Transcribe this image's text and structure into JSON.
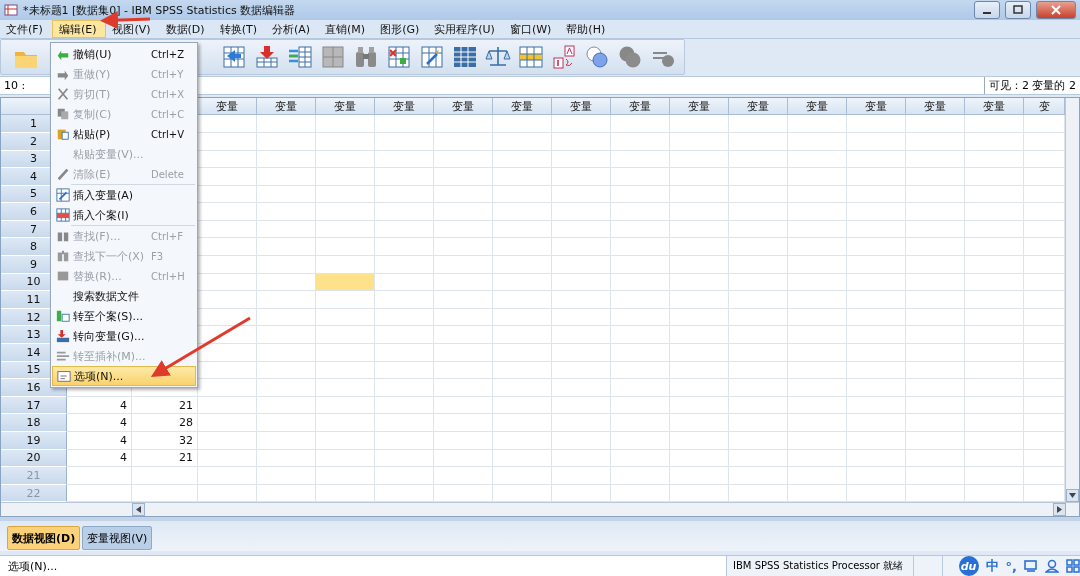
{
  "window": {
    "title": "*未标题1 [数据集0] - IBM SPSS Statistics 数据编辑器"
  },
  "menu_bar": [
    {
      "label": "文件(F)",
      "selected": false
    },
    {
      "label": "编辑(E)",
      "selected": true
    },
    {
      "label": "视图(V)",
      "selected": false
    },
    {
      "label": "数据(D)",
      "selected": false
    },
    {
      "label": "转换(T)",
      "selected": false
    },
    {
      "label": "分析(A)",
      "selected": false
    },
    {
      "label": "直销(M)",
      "selected": false
    },
    {
      "label": "图形(G)",
      "selected": false
    },
    {
      "label": "实用程序(U)",
      "selected": false
    },
    {
      "label": "窗口(W)",
      "selected": false
    },
    {
      "label": "帮助(H)",
      "selected": false
    }
  ],
  "cell_editor": {
    "cell_ref": "10 :",
    "visible_info": "可见：2 变量的 2"
  },
  "grid": {
    "columns": [
      {
        "label": "变量",
        "selected": false
      },
      {
        "label": "变量",
        "selected": false
      },
      {
        "label": "变量",
        "selected": true
      },
      {
        "label": "变量",
        "selected": false
      },
      {
        "label": "变量",
        "selected": false
      },
      {
        "label": "变量",
        "selected": false
      },
      {
        "label": "变量",
        "selected": false
      },
      {
        "label": "变量",
        "selected": false
      },
      {
        "label": "变量",
        "selected": false
      },
      {
        "label": "变量",
        "selected": false
      },
      {
        "label": "变量",
        "selected": false
      },
      {
        "label": "变量",
        "selected": false
      },
      {
        "label": "变量",
        "selected": false
      },
      {
        "label": "变量",
        "selected": false
      },
      {
        "label": "变",
        "selected": false
      }
    ],
    "rows": [
      {
        "number": "1",
        "has_data": true,
        "selected": false
      },
      {
        "number": "2",
        "has_data": true,
        "selected": false
      },
      {
        "number": "3",
        "has_data": true,
        "selected": false
      },
      {
        "number": "4",
        "has_data": true,
        "selected": false
      },
      {
        "number": "5",
        "has_data": true,
        "selected": false
      },
      {
        "number": "6",
        "has_data": true,
        "selected": false
      },
      {
        "number": "7",
        "has_data": true,
        "selected": false
      },
      {
        "number": "8",
        "has_data": true,
        "selected": false
      },
      {
        "number": "9",
        "has_data": true,
        "selected": false
      },
      {
        "number": "10",
        "has_data": true,
        "selected": true
      },
      {
        "number": "11",
        "has_data": true,
        "selected": false
      },
      {
        "number": "12",
        "has_data": true,
        "selected": false
      },
      {
        "number": "13",
        "has_data": true,
        "selected": false
      },
      {
        "number": "14",
        "has_data": true,
        "selected": false
      },
      {
        "number": "15",
        "has_data": true,
        "selected": false
      },
      {
        "number": "16",
        "has_data": true,
        "selected": false
      },
      {
        "number": "17",
        "has_data": true,
        "selected": false,
        "values": [
          "4",
          "21"
        ]
      },
      {
        "number": "18",
        "has_data": true,
        "selected": false,
        "values": [
          "4",
          "28"
        ]
      },
      {
        "number": "19",
        "has_data": true,
        "selected": false,
        "values": [
          "4",
          "32"
        ]
      },
      {
        "number": "20",
        "has_data": true,
        "selected": false,
        "values": [
          "4",
          "21"
        ]
      },
      {
        "number": "21",
        "has_data": false,
        "selected": false
      },
      {
        "number": "22",
        "has_data": false,
        "selected": false
      }
    ]
  },
  "edit_menu": [
    {
      "kind": "item",
      "label": "撤销(U)",
      "shortcut": "Ctrl+Z",
      "disabled": false,
      "selected": false
    },
    {
      "kind": "item",
      "label": "重做(Y)",
      "shortcut": "Ctrl+Y",
      "disabled": true,
      "selected": false
    },
    {
      "kind": "item",
      "label": "剪切(T)",
      "shortcut": "Ctrl+X",
      "disabled": true,
      "selected": false
    },
    {
      "kind": "item",
      "label": "复制(C)",
      "shortcut": "Ctrl+C",
      "disabled": true,
      "selected": false
    },
    {
      "kind": "item",
      "label": "粘贴(P)",
      "shortcut": "Ctrl+V",
      "disabled": false,
      "selected": false
    },
    {
      "kind": "item",
      "label": "粘贴变量(V)...",
      "disabled": true,
      "selected": false
    },
    {
      "kind": "item",
      "label": "清除(E)",
      "shortcut": "Delete",
      "disabled": true,
      "selected": false
    },
    {
      "kind": "separator"
    },
    {
      "kind": "item",
      "label": "插入变量(A)",
      "disabled": false,
      "selected": false
    },
    {
      "kind": "item",
      "label": "插入个案(I)",
      "disabled": false,
      "selected": false
    },
    {
      "kind": "separator"
    },
    {
      "kind": "item",
      "label": "查找(F)...",
      "shortcut": "Ctrl+F",
      "disabled": true,
      "selected": false
    },
    {
      "kind": "item",
      "label": "查找下一个(X)",
      "shortcut": "F3",
      "disabled": true,
      "selected": false
    },
    {
      "kind": "item",
      "label": "替换(R)...",
      "shortcut": "Ctrl+H",
      "disabled": true,
      "selected": false
    },
    {
      "kind": "item",
      "label": "搜索数据文件",
      "disabled": false,
      "selected": false
    },
    {
      "kind": "item",
      "label": "转至个案(S)...",
      "disabled": false,
      "selected": false
    },
    {
      "kind": "item",
      "label": "转向变量(G)...",
      "disabled": false,
      "selected": false
    },
    {
      "kind": "item",
      "label": "转至插补(M)...",
      "disabled": true,
      "selected": false
    },
    {
      "kind": "item",
      "label": "选项(N)...",
      "disabled": false,
      "selected": true
    }
  ],
  "view_tabs": [
    {
      "label": "数据视图(D)",
      "selected": true
    },
    {
      "label": "变量视图(V)",
      "selected": false
    }
  ],
  "status_bar": {
    "message": "选项(N)...",
    "processor": "IBM SPSS Statistics Processor 就绪"
  },
  "ime_bar": {
    "logo": "du",
    "mode": "中",
    "punctuation": "°,"
  }
}
